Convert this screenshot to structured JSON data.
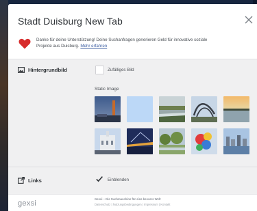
{
  "modal": {
    "title": "Stadt Duisburg New Tab",
    "close_icon": "close-icon",
    "thanks_text": "Danke für deine Unterstützung! Deine Suchanfragen generieren Geld für innovative soziale Projekte aus Duisburg.",
    "learn_more_link": "Mehr erfahren",
    "heart_color": "#d72c2c"
  },
  "background": {
    "label": "Hintergrundbild",
    "random_checkbox_label": "Zufälliges Bild",
    "random_checked": false,
    "static_label": "Static Image",
    "thumbnails": [
      {
        "name": "tower-dusk"
      },
      {
        "name": "plain-light-blue"
      },
      {
        "name": "park-lake"
      },
      {
        "name": "tiger-turtle-sculpture"
      },
      {
        "name": "sunset-river"
      },
      {
        "name": "city-hall"
      },
      {
        "name": "bridge-night"
      },
      {
        "name": "park-greenery"
      },
      {
        "name": "colorful-sculpture"
      },
      {
        "name": "harbor-skyline"
      }
    ]
  },
  "links": {
    "label": "Links",
    "show_checkbox_label": "Einblenden",
    "show_checked": true
  },
  "footer": {
    "logo": "gexsi",
    "tagline": "Gexsi – Die Suchmaschine für eine bessere Welt",
    "links": [
      "Datenschutz",
      "Nutzungsbedingungen",
      "Impressum",
      "Kontakt"
    ],
    "separator": " | "
  }
}
